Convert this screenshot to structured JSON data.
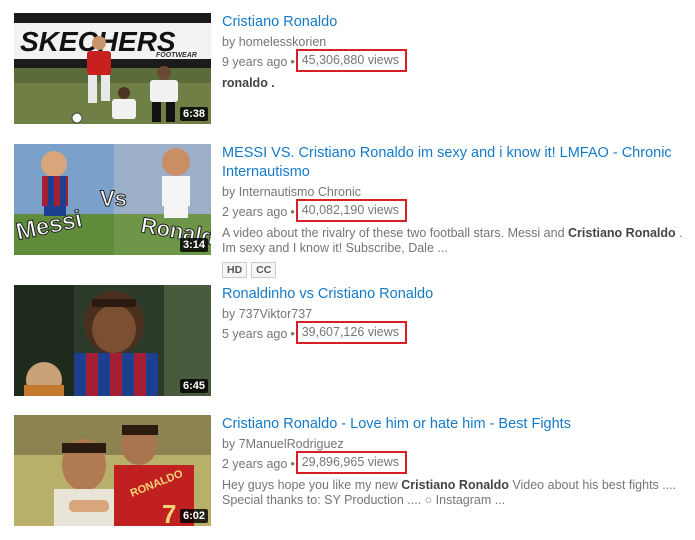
{
  "results": [
    {
      "title": "Cristiano Ronaldo",
      "channel_prefix": "by",
      "channel": "homelesskorien",
      "age": "9 years ago",
      "views": "45,306,880 views",
      "description_plain": "ronaldo .",
      "duration": "6:38",
      "thumb_text": "SKECHERS",
      "thumb_subtext": "FOOTWEAR"
    },
    {
      "title": "MESSI VS. Cristiano Ronaldo im sexy and i know it! LMFAO - Chronic Internautismo",
      "channel_prefix": "by",
      "channel": "Internautismo Chronic",
      "age": "2 years ago",
      "views": "40,082,190 views",
      "description_pre": "A video about the rivalry of these two football stars. Messi and ",
      "description_bold": "Cristiano Ronaldo",
      "description_post": " . Im sexy and I know it! Subscribe, Dale ...",
      "badges": [
        "HD",
        "CC"
      ],
      "duration": "3:14",
      "thumb_left": "Messi",
      "thumb_mid": "Vs",
      "thumb_right": "Ronaldo"
    },
    {
      "title": "Ronaldinho vs Cristiano Ronaldo",
      "channel_prefix": "by",
      "channel": "737Viktor737",
      "age": "5 years ago",
      "views": "39,607,126 views",
      "duration": "6:45"
    },
    {
      "title": "Cristiano Ronaldo - Love him or hate him - Best Fights",
      "channel_prefix": "by",
      "channel": "7ManuelRodriguez",
      "age": "2 years ago",
      "views": "29,896,965 views",
      "description_pre": "Hey guys hope you like my new ",
      "description_bold": "Cristiano Ronaldo",
      "description_post": " Video about his best fights .... Special thanks to: SY Production .... ○ Instagram ...",
      "duration": "6:02",
      "thumb_shirt": "RONALDO",
      "thumb_number": "7"
    }
  ],
  "colors": {
    "title_link": "#167ac6",
    "highlight_box": "#d61f26",
    "meta_text": "#767676"
  },
  "separator": "•"
}
